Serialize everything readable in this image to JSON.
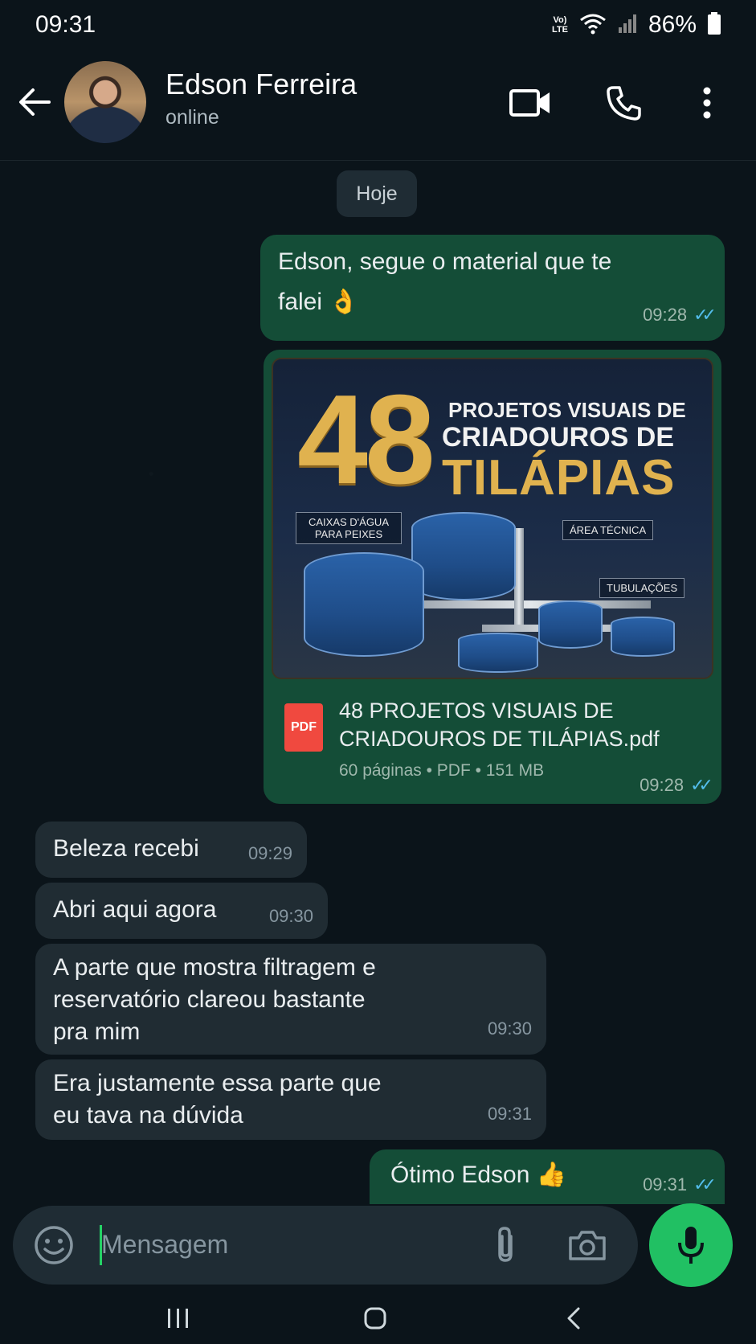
{
  "status_bar": {
    "time": "09:31",
    "network": "Vo)) LTE",
    "battery": "86%"
  },
  "header": {
    "contact_name": "Edson Ferreira",
    "contact_status": "online"
  },
  "chat": {
    "date_label": "Hoje",
    "messages": [
      {
        "direction": "out",
        "text_line1": "Edson, segue o material que te",
        "text_line2": "falei 👌",
        "time": "09:28"
      },
      {
        "direction": "out",
        "type": "document",
        "cover_big": "48",
        "cover_title1": "PROJETOS VISUAIS DE",
        "cover_title2": "CRIADOUROS DE",
        "cover_title3": "TILÁPIAS",
        "cover_label_left": "CAIXAS D'ÁGUA PARA PEIXES",
        "cover_label_tech": "ÁREA TÉCNICA",
        "cover_label_pipes": "TUBULAÇÕES",
        "file_icon": "PDF",
        "file_name": "48 PROJETOS VISUAIS DE CRIADOUROS DE TILÁPIAS.pdf",
        "file_meta": "60 páginas • PDF • 151 MB",
        "time": "09:28"
      },
      {
        "direction": "in",
        "text": "Beleza recebi",
        "time": "09:29"
      },
      {
        "direction": "in",
        "text": "Abri aqui agora",
        "time": "09:30"
      },
      {
        "direction": "in",
        "text_line1": "A parte que mostra filtragem e",
        "text_line2": "reservatório clareou bastante",
        "text_line3": "pra mim",
        "time": "09:30"
      },
      {
        "direction": "in",
        "text_line1": "Era justamente essa parte que",
        "text_line2": "eu tava na dúvida",
        "time": "09:31"
      },
      {
        "direction": "out",
        "text": "Ótimo Edson 👍",
        "time": "09:31"
      }
    ]
  },
  "composer": {
    "placeholder": "Mensagem"
  },
  "colors": {
    "background": "#0b141a",
    "outgoing_bubble": "#144d37",
    "incoming_bubble": "#202c33",
    "accent": "#21c063",
    "read_ticks": "#53bdeb"
  },
  "icons": [
    "back-arrow-icon",
    "video-call-icon",
    "phone-icon",
    "more-vert-icon",
    "emoji-icon",
    "attach-icon",
    "camera-icon",
    "mic-icon",
    "recent-apps-icon",
    "home-icon",
    "nav-back-icon"
  ]
}
